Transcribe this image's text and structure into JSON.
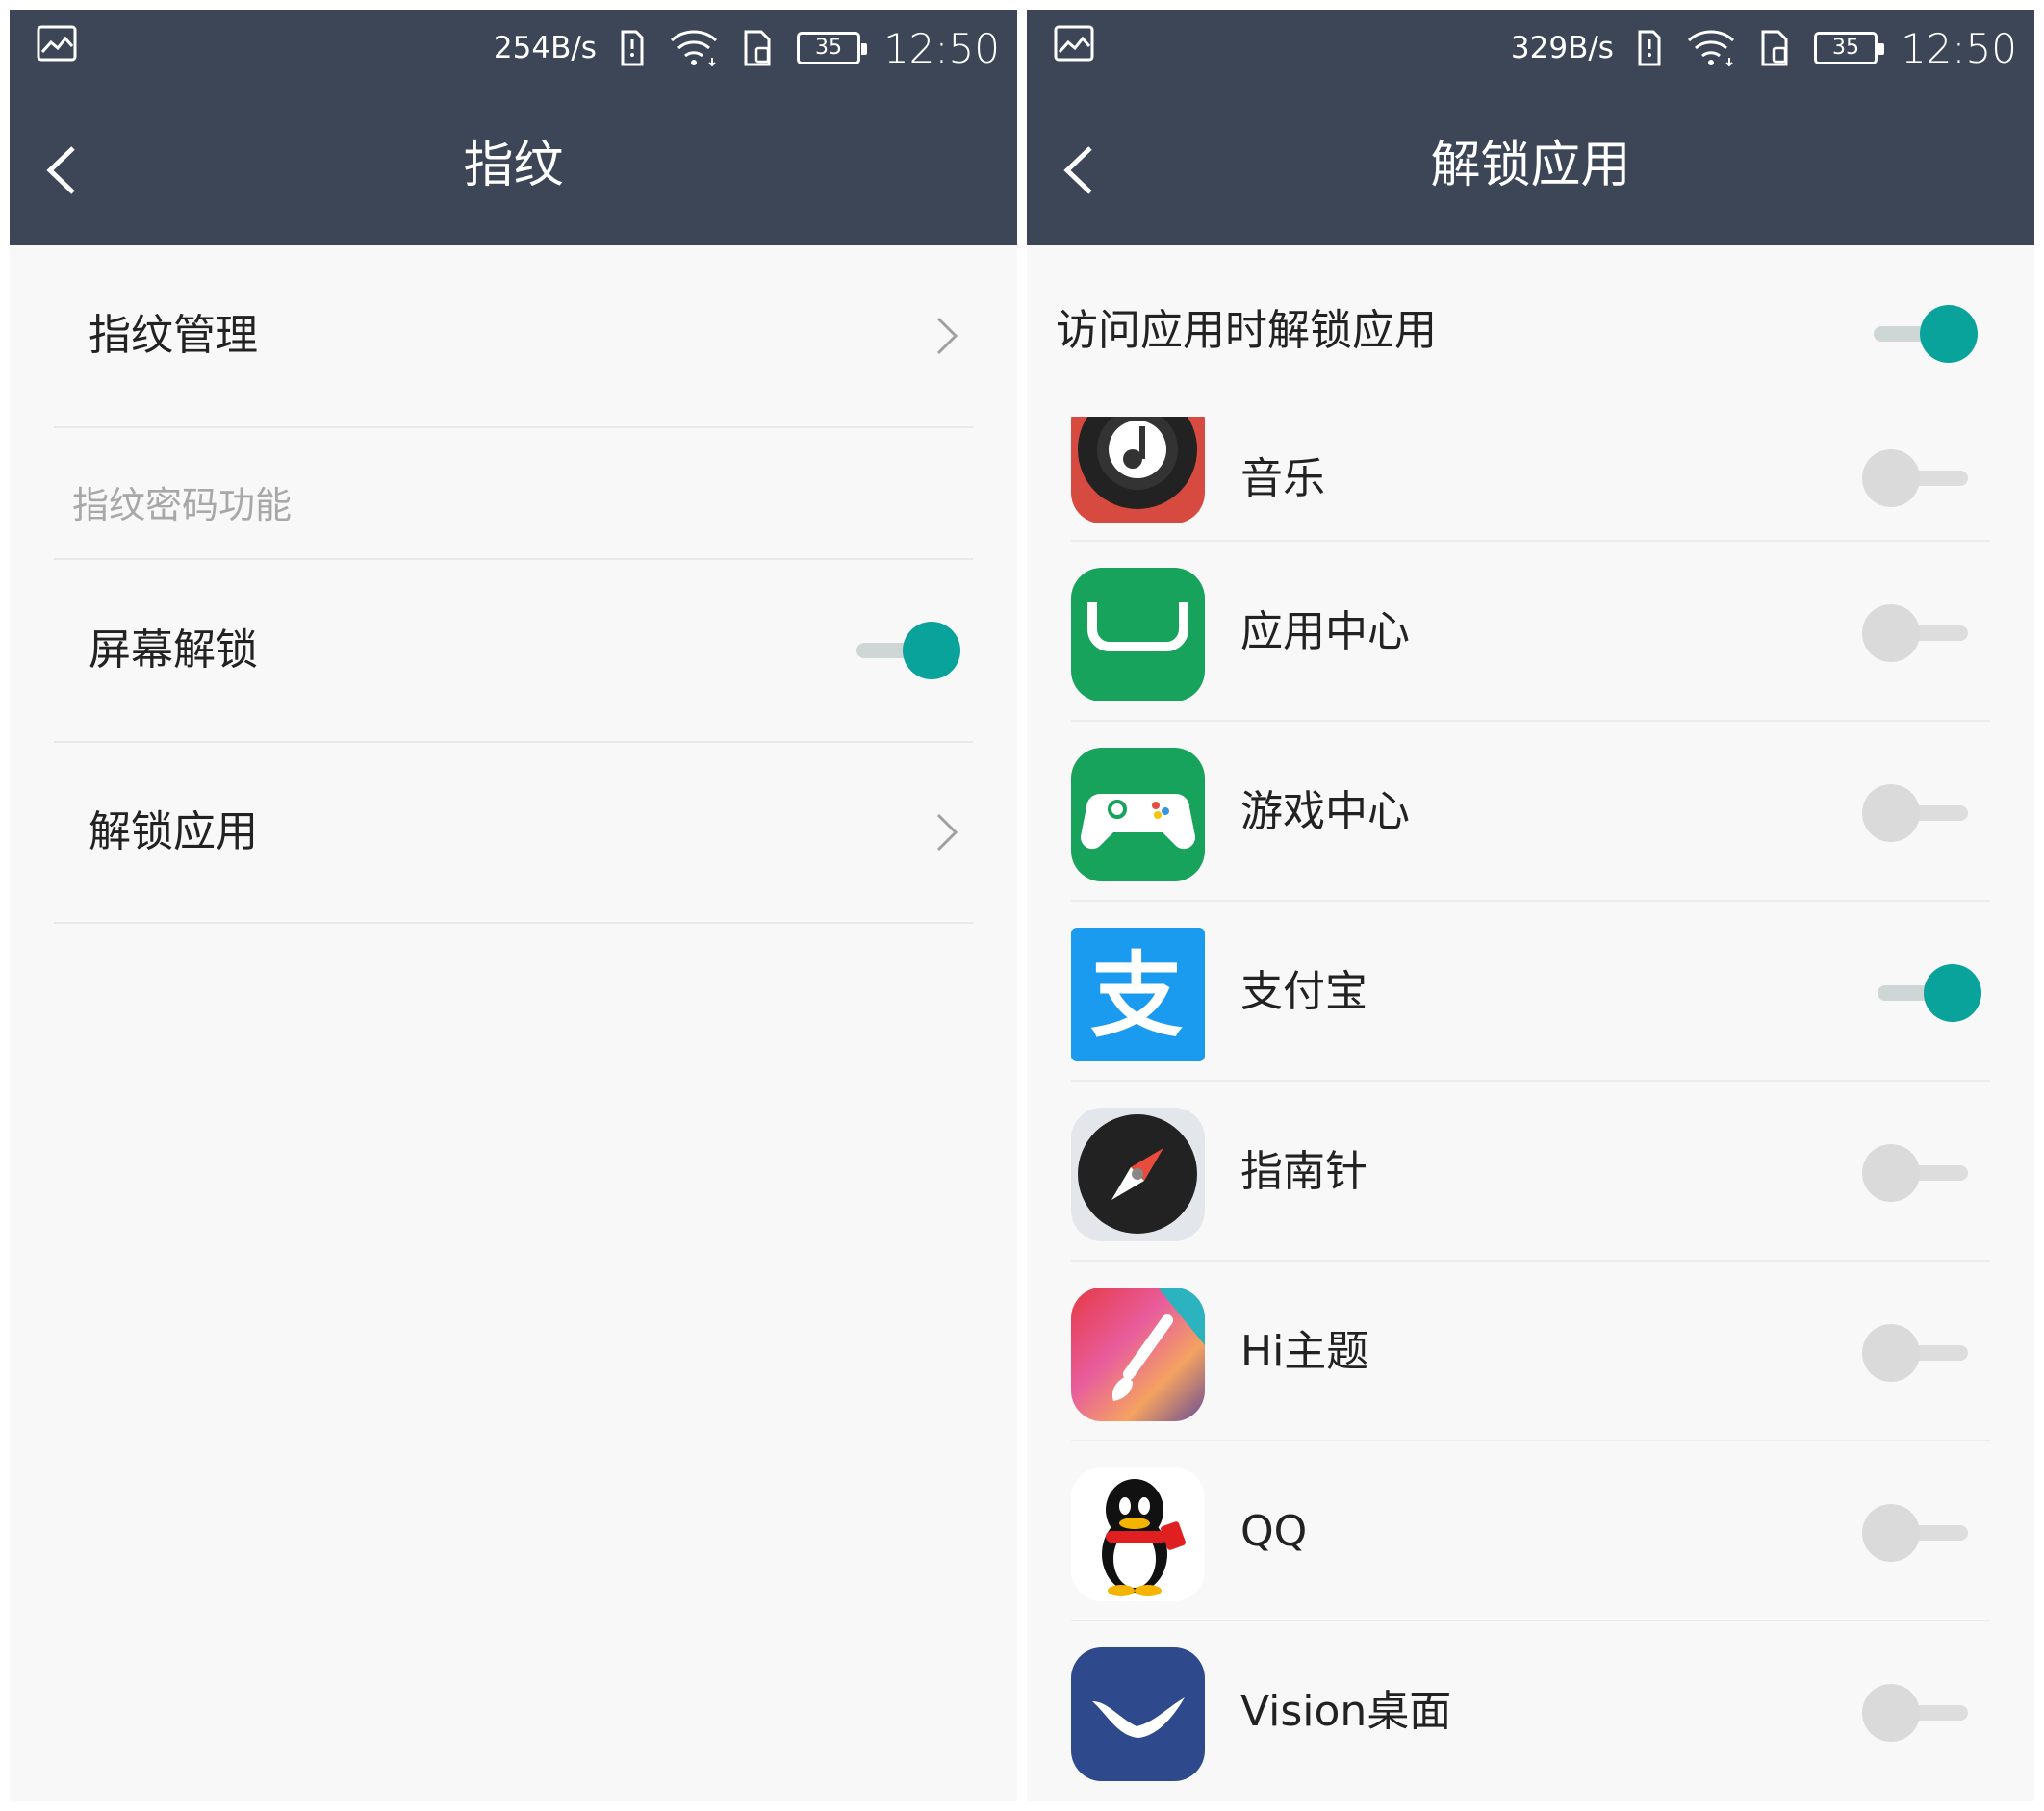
{
  "left": {
    "status": {
      "speed": "254B/s",
      "battery": "35",
      "time": "12:50"
    },
    "title": "指纹",
    "items": {
      "manage": "指纹管理",
      "section": "指纹密码功能",
      "screen_unlock": "屏幕解锁",
      "unlock_apps": "解锁应用"
    },
    "screen_unlock_on": true
  },
  "right": {
    "status": {
      "speed": "329B/s",
      "battery": "35",
      "time": "12:50"
    },
    "title": "解锁应用",
    "master": {
      "label": "访问应用时解锁应用",
      "on": true
    },
    "apps": [
      {
        "name": "音乐",
        "icon": "music-app-icon",
        "on": false
      },
      {
        "name": "应用中心",
        "icon": "app-center-icon",
        "on": false
      },
      {
        "name": "游戏中心",
        "icon": "game-center-icon",
        "on": false
      },
      {
        "name": "支付宝",
        "icon": "alipay-icon",
        "on": true
      },
      {
        "name": "指南针",
        "icon": "compass-icon",
        "on": false
      },
      {
        "name": "Hi主题",
        "icon": "hi-theme-icon",
        "on": false
      },
      {
        "name": "QQ",
        "icon": "qq-icon",
        "on": false
      },
      {
        "name": "Vision桌面",
        "icon": "vision-launcher-icon",
        "on": false
      }
    ]
  },
  "colors": {
    "header": "#3c4657",
    "accent": "#0aa39b",
    "background": "#f8f8f8"
  }
}
